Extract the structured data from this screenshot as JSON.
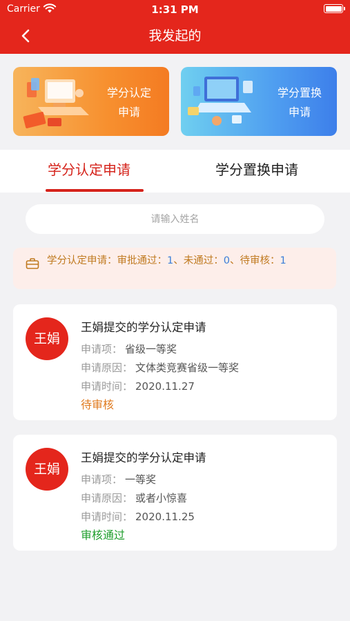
{
  "status_bar": {
    "carrier": "Carrier",
    "time": "1:31 PM"
  },
  "nav": {
    "title": "我发起的"
  },
  "banners": [
    {
      "label_line1": "学分认定",
      "label_line2": "申请"
    },
    {
      "label_line1": "学分置换",
      "label_line2": "申请"
    }
  ],
  "tabs": [
    {
      "label": "学分认定申请",
      "active": true
    },
    {
      "label": "学分置换申请",
      "active": false
    }
  ],
  "search": {
    "placeholder": "请输入姓名"
  },
  "summary": {
    "prefix": "学分认定申请：审批通过：",
    "approved": "1",
    "mid": "、未通过：",
    "rejected": "0",
    "mid2": "、待审核：",
    "pending": "1"
  },
  "colors": {
    "brand": "#e4261c",
    "pending": "#e07b20",
    "approved": "#1f9e2c",
    "count": "#3b7ed8"
  },
  "records": [
    {
      "avatar": "王娟",
      "title": "王娟提交的学分认定申请",
      "item_label": "申请项：",
      "item_value": "省级一等奖",
      "reason_label": "申请原因：",
      "reason_value": "文体类竞赛省级一等奖",
      "time_label": "申请时间：",
      "time_value": "2020.11.27",
      "status": "待审核"
    },
    {
      "avatar": "王娟",
      "title": "王娟提交的学分认定申请",
      "item_label": "申请项：",
      "item_value": "一等奖",
      "reason_label": "申请原因：",
      "reason_value": "或者小惊喜",
      "time_label": "申请时间：",
      "time_value": "2020.11.25",
      "status": "审核通过"
    }
  ]
}
